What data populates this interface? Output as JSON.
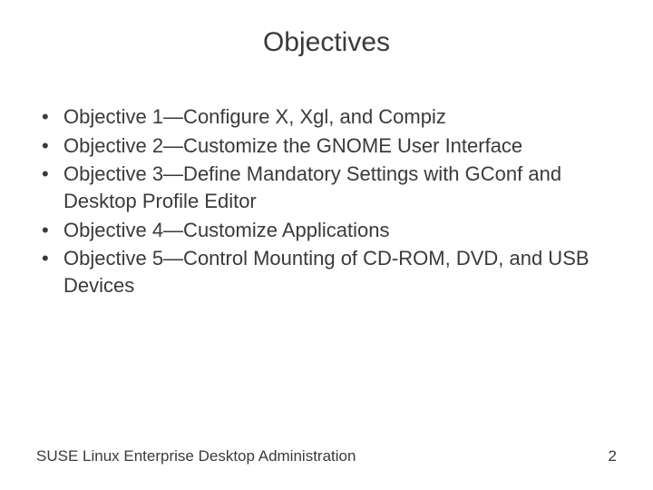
{
  "title": "Objectives",
  "bullets": [
    "Objective 1—Configure X, Xgl, and Compiz",
    "Objective 2—Customize the GNOME User Interface",
    "Objective 3—Define Mandatory Settings with GConf and Desktop Profile Editor",
    "Objective 4—Customize Applications",
    "Objective 5—Control Mounting of CD-ROM, DVD, and USB Devices"
  ],
  "footer": {
    "left": "SUSE Linux Enterprise Desktop Administration",
    "page": "2"
  }
}
